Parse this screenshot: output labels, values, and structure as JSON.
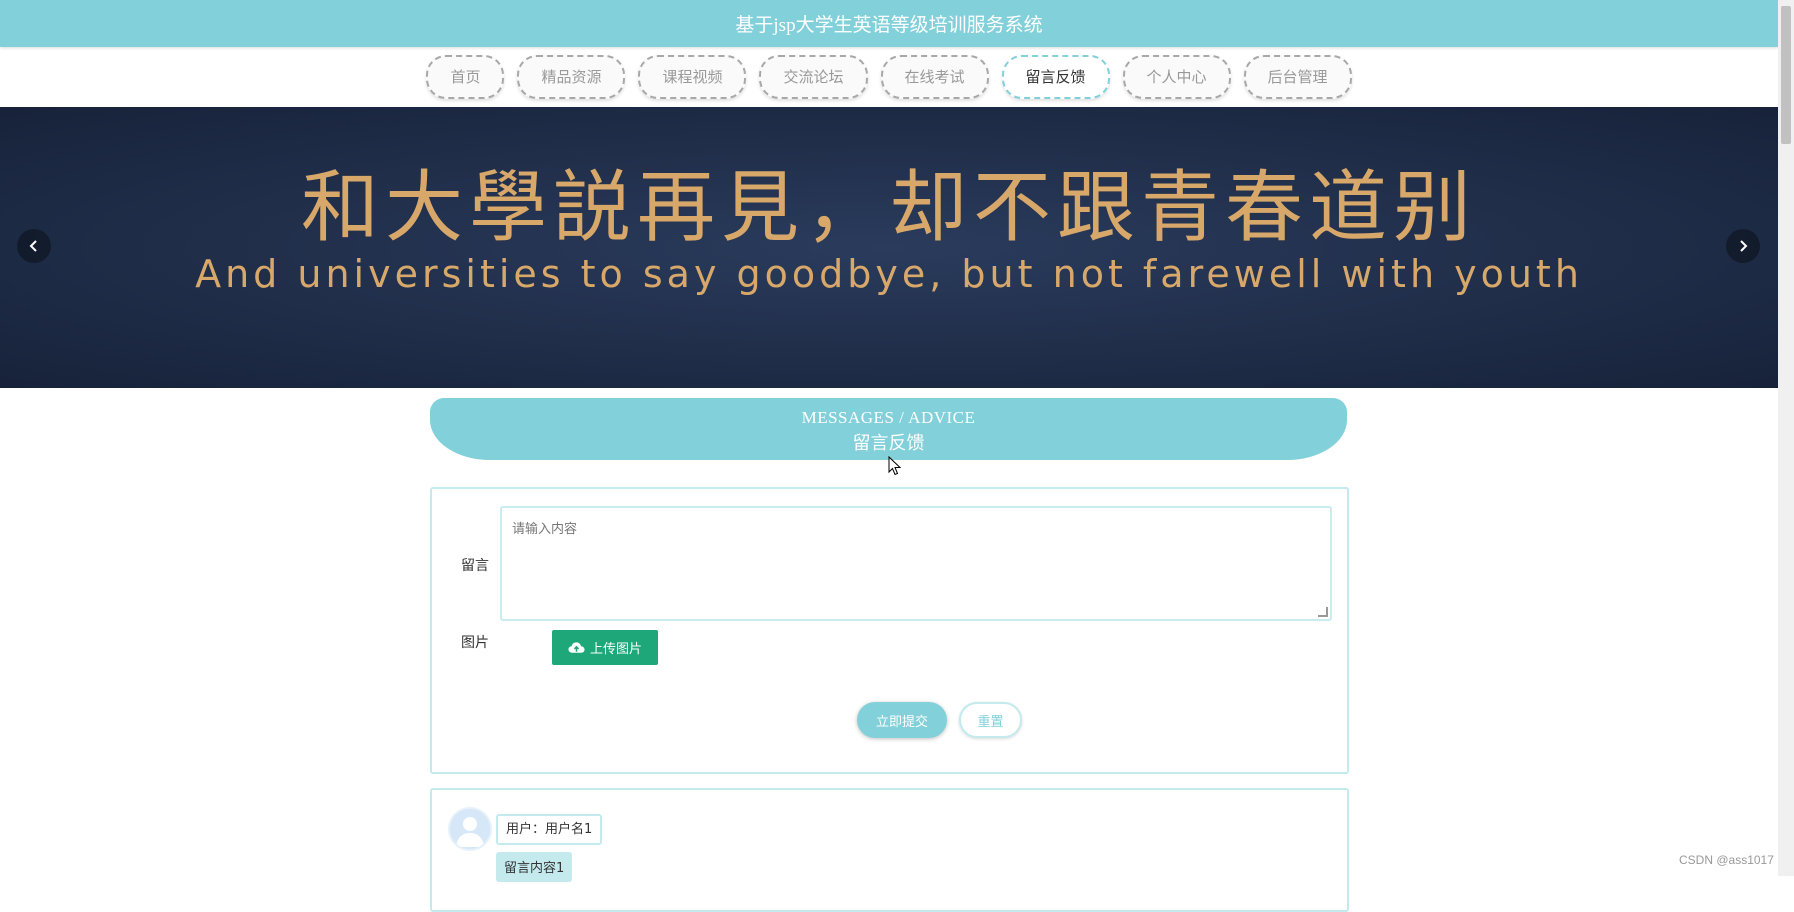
{
  "header": {
    "title": "基于jsp大学生英语等级培训服务系统"
  },
  "nav": {
    "items": [
      {
        "label": "首页",
        "active": false
      },
      {
        "label": "精品资源",
        "active": false
      },
      {
        "label": "课程视频",
        "active": false
      },
      {
        "label": "交流论坛",
        "active": false
      },
      {
        "label": "在线考试",
        "active": false
      },
      {
        "label": "留言反馈",
        "active": true
      },
      {
        "label": "个人中心",
        "active": false
      },
      {
        "label": "后台管理",
        "active": false
      }
    ]
  },
  "banner": {
    "line_cn": "和大學説再見，却不跟青春道别",
    "line_en": "And universities to say goodbye, but not farewell with youth",
    "prev_icon": "chevron-left-icon",
    "next_icon": "chevron-right-icon"
  },
  "section": {
    "title_en": "MESSAGES / ADVICE",
    "title_cn": "留言反馈"
  },
  "form": {
    "message_label": "留言",
    "message_placeholder": "请输入内容",
    "image_label": "图片",
    "upload_label": "上传图片",
    "upload_icon": "cloud-upload-icon",
    "submit_label": "立即提交",
    "reset_label": "重置"
  },
  "messages": [
    {
      "user": "用户：用户名1",
      "content": "留言内容1",
      "avatar_icon": "user-avatar-icon"
    }
  ],
  "watermark": "CSDN @ass1017",
  "colors": {
    "accent": "#82d0d9",
    "upload_green": "#1ea87a",
    "banner_text": "#d8a86a",
    "banner_bg": "#1d2a44"
  }
}
